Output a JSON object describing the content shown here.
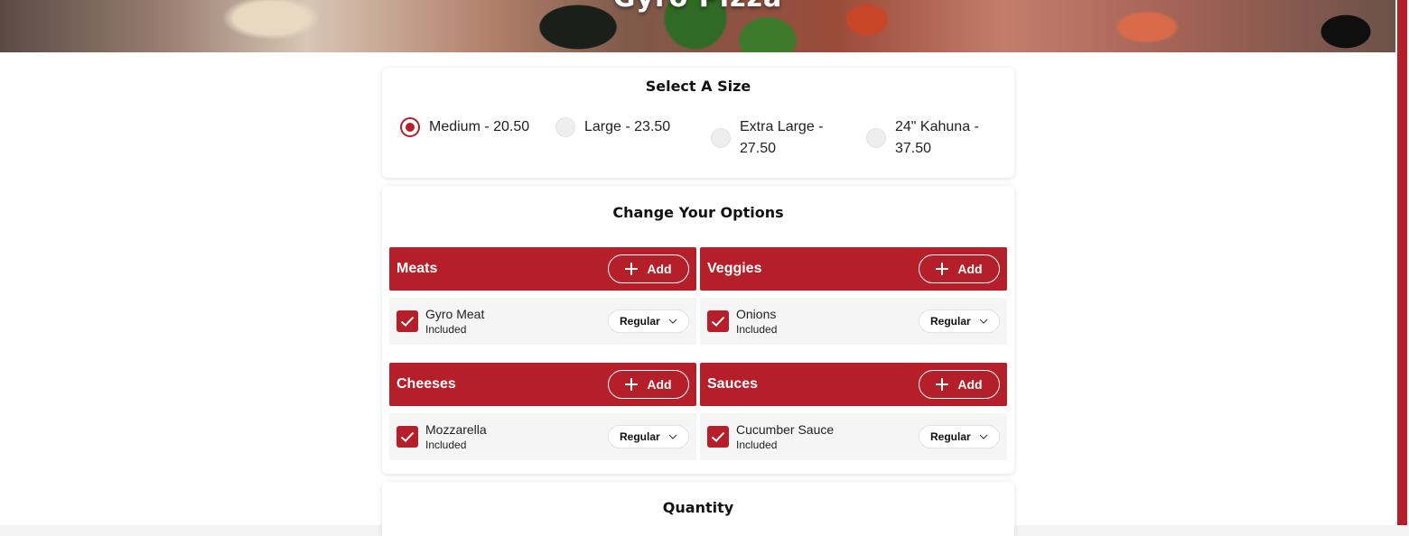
{
  "hero": {
    "title": "Gyro Pizza"
  },
  "size_section": {
    "title": "Select A Size",
    "options": [
      {
        "label": "Medium - 20.50",
        "selected": true
      },
      {
        "label": "Large - 23.50",
        "selected": false
      },
      {
        "label_line1": "Extra Large -",
        "label_line2": "27.50",
        "selected": false
      },
      {
        "label_line1": "24\" Kahuna -",
        "label_line2": "37.50",
        "selected": false
      }
    ]
  },
  "options_section": {
    "title": "Change Your Options",
    "groups": [
      {
        "name": "Meats",
        "add_label": "Add",
        "item": {
          "name": "Gyro Meat",
          "status": "Included",
          "amount": "Regular"
        }
      },
      {
        "name": "Veggies",
        "add_label": "Add",
        "item": {
          "name": "Onions",
          "status": "Included",
          "amount": "Regular"
        }
      },
      {
        "name": "Cheeses",
        "add_label": "Add",
        "item": {
          "name": "Mozzarella",
          "status": "Included",
          "amount": "Regular"
        }
      },
      {
        "name": "Sauces",
        "add_label": "Add",
        "item": {
          "name": "Cucumber Sauce",
          "status": "Included",
          "amount": "Regular"
        }
      }
    ]
  },
  "quantity_section": {
    "title": "Quantity"
  },
  "colors": {
    "accent": "#b51f2a",
    "item_bg": "#f5f5f6",
    "radio_bg": "#eeeeee"
  },
  "icons": [
    "plus-icon",
    "check-icon",
    "chevron-down-icon"
  ]
}
